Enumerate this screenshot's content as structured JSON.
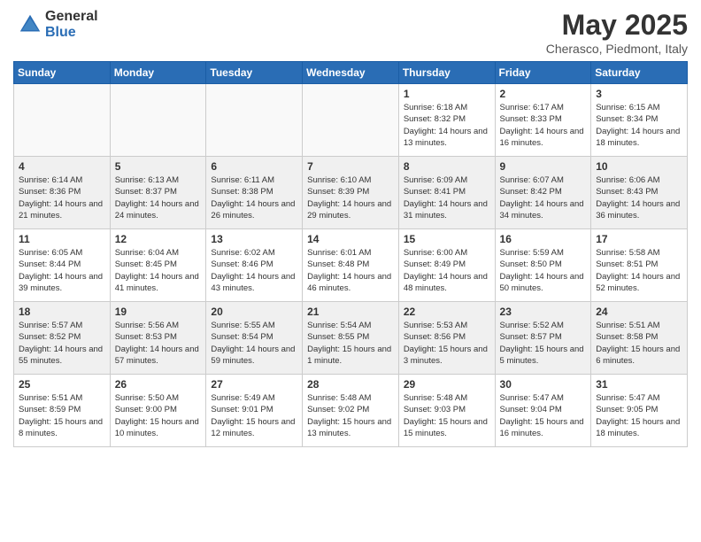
{
  "header": {
    "logo_general": "General",
    "logo_blue": "Blue",
    "title": "May 2025",
    "location": "Cherasco, Piedmont, Italy"
  },
  "weekdays": [
    "Sunday",
    "Monday",
    "Tuesday",
    "Wednesday",
    "Thursday",
    "Friday",
    "Saturday"
  ],
  "weeks": [
    [
      {
        "day": "",
        "sunrise": "",
        "sunset": "",
        "daylight": ""
      },
      {
        "day": "",
        "sunrise": "",
        "sunset": "",
        "daylight": ""
      },
      {
        "day": "",
        "sunrise": "",
        "sunset": "",
        "daylight": ""
      },
      {
        "day": "",
        "sunrise": "",
        "sunset": "",
        "daylight": ""
      },
      {
        "day": "1",
        "sunrise": "Sunrise: 6:18 AM",
        "sunset": "Sunset: 8:32 PM",
        "daylight": "Daylight: 14 hours and 13 minutes."
      },
      {
        "day": "2",
        "sunrise": "Sunrise: 6:17 AM",
        "sunset": "Sunset: 8:33 PM",
        "daylight": "Daylight: 14 hours and 16 minutes."
      },
      {
        "day": "3",
        "sunrise": "Sunrise: 6:15 AM",
        "sunset": "Sunset: 8:34 PM",
        "daylight": "Daylight: 14 hours and 18 minutes."
      }
    ],
    [
      {
        "day": "4",
        "sunrise": "Sunrise: 6:14 AM",
        "sunset": "Sunset: 8:36 PM",
        "daylight": "Daylight: 14 hours and 21 minutes."
      },
      {
        "day": "5",
        "sunrise": "Sunrise: 6:13 AM",
        "sunset": "Sunset: 8:37 PM",
        "daylight": "Daylight: 14 hours and 24 minutes."
      },
      {
        "day": "6",
        "sunrise": "Sunrise: 6:11 AM",
        "sunset": "Sunset: 8:38 PM",
        "daylight": "Daylight: 14 hours and 26 minutes."
      },
      {
        "day": "7",
        "sunrise": "Sunrise: 6:10 AM",
        "sunset": "Sunset: 8:39 PM",
        "daylight": "Daylight: 14 hours and 29 minutes."
      },
      {
        "day": "8",
        "sunrise": "Sunrise: 6:09 AM",
        "sunset": "Sunset: 8:41 PM",
        "daylight": "Daylight: 14 hours and 31 minutes."
      },
      {
        "day": "9",
        "sunrise": "Sunrise: 6:07 AM",
        "sunset": "Sunset: 8:42 PM",
        "daylight": "Daylight: 14 hours and 34 minutes."
      },
      {
        "day": "10",
        "sunrise": "Sunrise: 6:06 AM",
        "sunset": "Sunset: 8:43 PM",
        "daylight": "Daylight: 14 hours and 36 minutes."
      }
    ],
    [
      {
        "day": "11",
        "sunrise": "Sunrise: 6:05 AM",
        "sunset": "Sunset: 8:44 PM",
        "daylight": "Daylight: 14 hours and 39 minutes."
      },
      {
        "day": "12",
        "sunrise": "Sunrise: 6:04 AM",
        "sunset": "Sunset: 8:45 PM",
        "daylight": "Daylight: 14 hours and 41 minutes."
      },
      {
        "day": "13",
        "sunrise": "Sunrise: 6:02 AM",
        "sunset": "Sunset: 8:46 PM",
        "daylight": "Daylight: 14 hours and 43 minutes."
      },
      {
        "day": "14",
        "sunrise": "Sunrise: 6:01 AM",
        "sunset": "Sunset: 8:48 PM",
        "daylight": "Daylight: 14 hours and 46 minutes."
      },
      {
        "day": "15",
        "sunrise": "Sunrise: 6:00 AM",
        "sunset": "Sunset: 8:49 PM",
        "daylight": "Daylight: 14 hours and 48 minutes."
      },
      {
        "day": "16",
        "sunrise": "Sunrise: 5:59 AM",
        "sunset": "Sunset: 8:50 PM",
        "daylight": "Daylight: 14 hours and 50 minutes."
      },
      {
        "day": "17",
        "sunrise": "Sunrise: 5:58 AM",
        "sunset": "Sunset: 8:51 PM",
        "daylight": "Daylight: 14 hours and 52 minutes."
      }
    ],
    [
      {
        "day": "18",
        "sunrise": "Sunrise: 5:57 AM",
        "sunset": "Sunset: 8:52 PM",
        "daylight": "Daylight: 14 hours and 55 minutes."
      },
      {
        "day": "19",
        "sunrise": "Sunrise: 5:56 AM",
        "sunset": "Sunset: 8:53 PM",
        "daylight": "Daylight: 14 hours and 57 minutes."
      },
      {
        "day": "20",
        "sunrise": "Sunrise: 5:55 AM",
        "sunset": "Sunset: 8:54 PM",
        "daylight": "Daylight: 14 hours and 59 minutes."
      },
      {
        "day": "21",
        "sunrise": "Sunrise: 5:54 AM",
        "sunset": "Sunset: 8:55 PM",
        "daylight": "Daylight: 15 hours and 1 minute."
      },
      {
        "day": "22",
        "sunrise": "Sunrise: 5:53 AM",
        "sunset": "Sunset: 8:56 PM",
        "daylight": "Daylight: 15 hours and 3 minutes."
      },
      {
        "day": "23",
        "sunrise": "Sunrise: 5:52 AM",
        "sunset": "Sunset: 8:57 PM",
        "daylight": "Daylight: 15 hours and 5 minutes."
      },
      {
        "day": "24",
        "sunrise": "Sunrise: 5:51 AM",
        "sunset": "Sunset: 8:58 PM",
        "daylight": "Daylight: 15 hours and 6 minutes."
      }
    ],
    [
      {
        "day": "25",
        "sunrise": "Sunrise: 5:51 AM",
        "sunset": "Sunset: 8:59 PM",
        "daylight": "Daylight: 15 hours and 8 minutes."
      },
      {
        "day": "26",
        "sunrise": "Sunrise: 5:50 AM",
        "sunset": "Sunset: 9:00 PM",
        "daylight": "Daylight: 15 hours and 10 minutes."
      },
      {
        "day": "27",
        "sunrise": "Sunrise: 5:49 AM",
        "sunset": "Sunset: 9:01 PM",
        "daylight": "Daylight: 15 hours and 12 minutes."
      },
      {
        "day": "28",
        "sunrise": "Sunrise: 5:48 AM",
        "sunset": "Sunset: 9:02 PM",
        "daylight": "Daylight: 15 hours and 13 minutes."
      },
      {
        "day": "29",
        "sunrise": "Sunrise: 5:48 AM",
        "sunset": "Sunset: 9:03 PM",
        "daylight": "Daylight: 15 hours and 15 minutes."
      },
      {
        "day": "30",
        "sunrise": "Sunrise: 5:47 AM",
        "sunset": "Sunset: 9:04 PM",
        "daylight": "Daylight: 15 hours and 16 minutes."
      },
      {
        "day": "31",
        "sunrise": "Sunrise: 5:47 AM",
        "sunset": "Sunset: 9:05 PM",
        "daylight": "Daylight: 15 hours and 18 minutes."
      }
    ]
  ]
}
